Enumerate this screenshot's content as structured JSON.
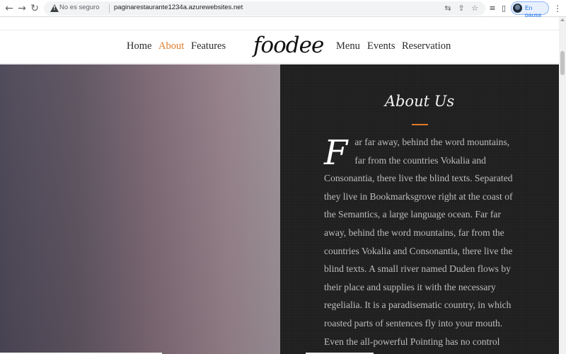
{
  "browser": {
    "security_label": "No es seguro",
    "url": "paginarestaurante1234a.azurewebsites.net",
    "profile_status": "En pausa",
    "icons": [
      "back-icon",
      "forward-icon",
      "reload-icon",
      "not-secure-icon",
      "translate-icon",
      "share-icon",
      "star-icon",
      "reading-list-icon",
      "side-panel-icon",
      "avatar",
      "more-menu-icon"
    ]
  },
  "site": {
    "brand": "foodee",
    "nav": {
      "home": "Home",
      "about": "About",
      "features": "Features",
      "menu": "Menu",
      "events": "Events",
      "reservation": "Reservation"
    },
    "about": {
      "title": "About Us",
      "dropcap": "F",
      "text": "ar far away, behind the word mountains, far from the countries Vokalia and Consonantia, there live the blind texts. Separated they live in Bookmarksgrove right at the coast of the Semantics, a large language ocean. Far far away, behind the word mountains, far from the countries Vokalia and Consonantia, there live the blind texts. A small river named Duden flows by their place and supplies it with the necessary regelialia. It is a paradisematic country, in which roasted parts of sentences fly into your mouth. Even the all-powerful Pointing has no control about the blind texts it is an almost"
    }
  },
  "colors": {
    "accent": "#e07b2a",
    "about_bg": "#1f1f1f"
  }
}
